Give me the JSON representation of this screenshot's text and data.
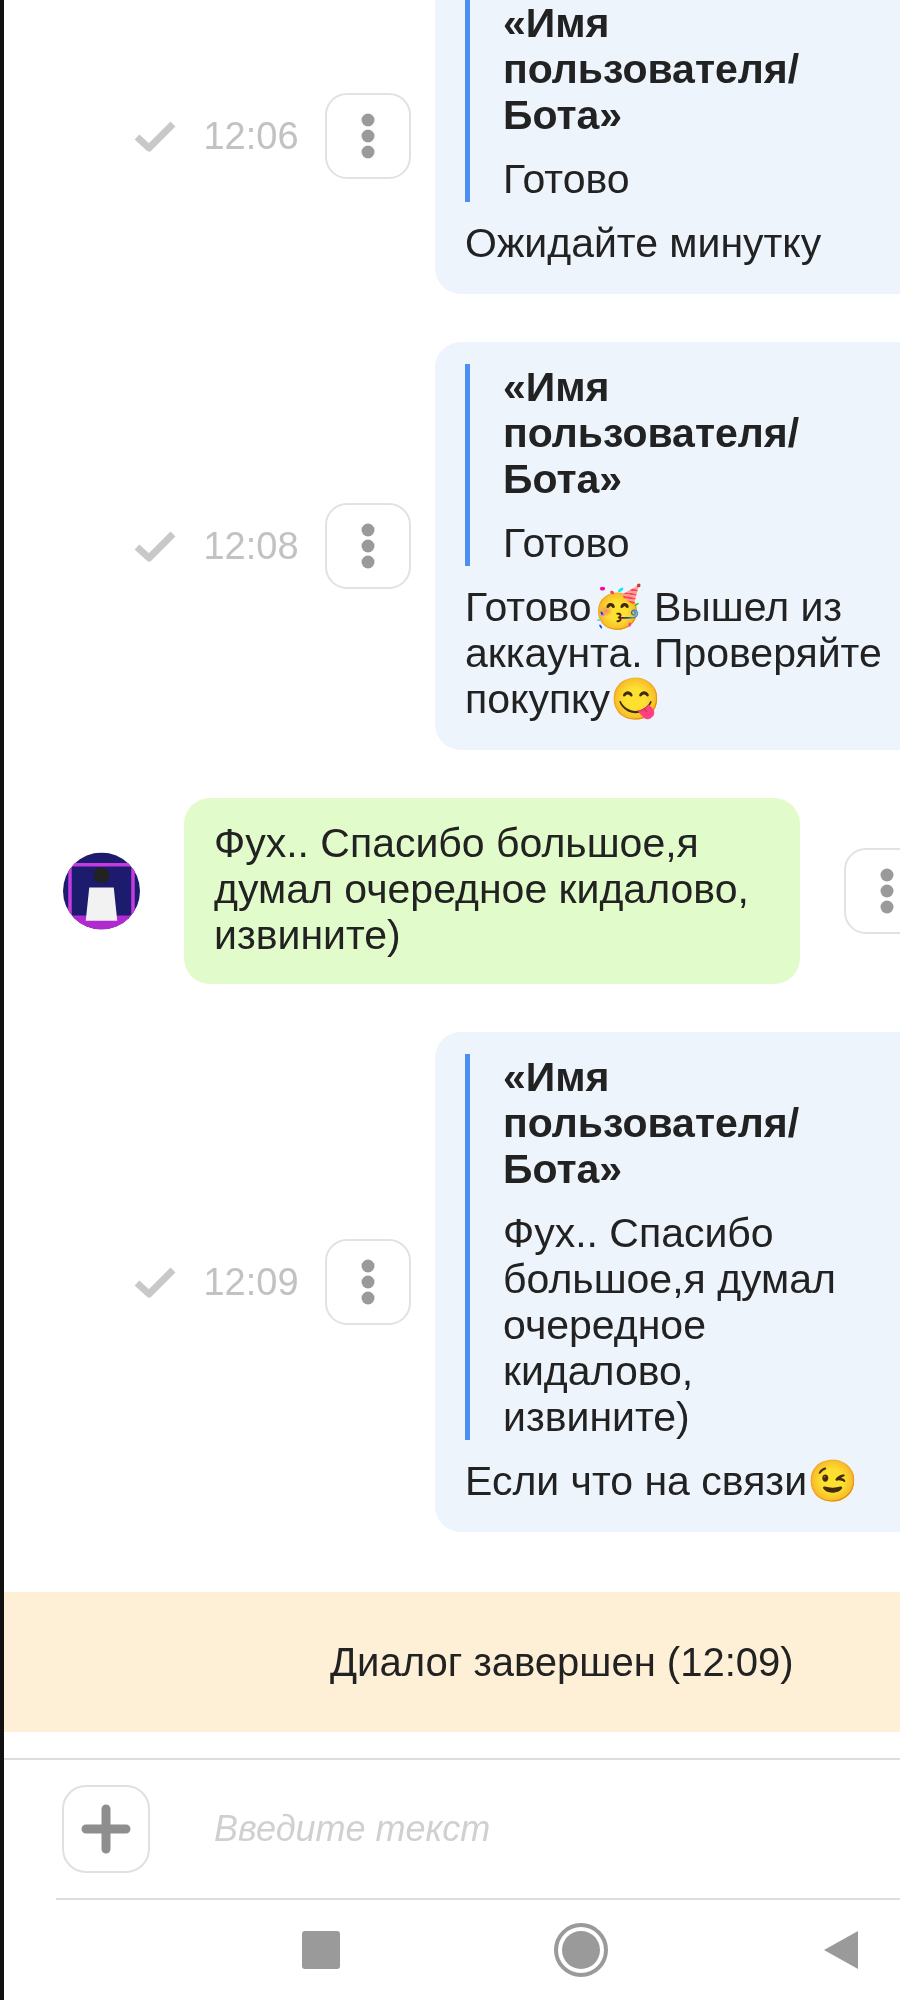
{
  "messages": [
    {
      "kind": "bot",
      "time": "12:06",
      "delivered": true,
      "quote": {
        "author": "«Имя пользователя/ Бота»",
        "text": "Готово"
      },
      "body": [
        {
          "kind": "text",
          "text": "Ожидайте минутку"
        }
      ]
    },
    {
      "kind": "bot",
      "time": "12:08",
      "delivered": true,
      "quote": {
        "author": "«Имя пользователя/ Бота»",
        "text": "Готово"
      },
      "body": [
        {
          "kind": "text",
          "text": "Готово🥳 Вышел из аккаунта. Проверяйте покупку😋"
        }
      ]
    },
    {
      "kind": "user",
      "body": [
        {
          "kind": "text",
          "text": "Фух.. Спасибо большое,я думал очередное кидалово, извините)"
        }
      ]
    },
    {
      "kind": "bot",
      "time": "12:09",
      "delivered": true,
      "quote": {
        "author": "«Имя пользователя/ Бота»",
        "text": "Фух.. Спасибо большое,я думал очередное кидалово, извините)"
      },
      "body": [
        {
          "kind": "text",
          "text": "Если что на связи😉"
        }
      ]
    }
  ],
  "status_banner": "Диалог завершен (12:09)",
  "composer": {
    "placeholder": "Введите текст"
  }
}
